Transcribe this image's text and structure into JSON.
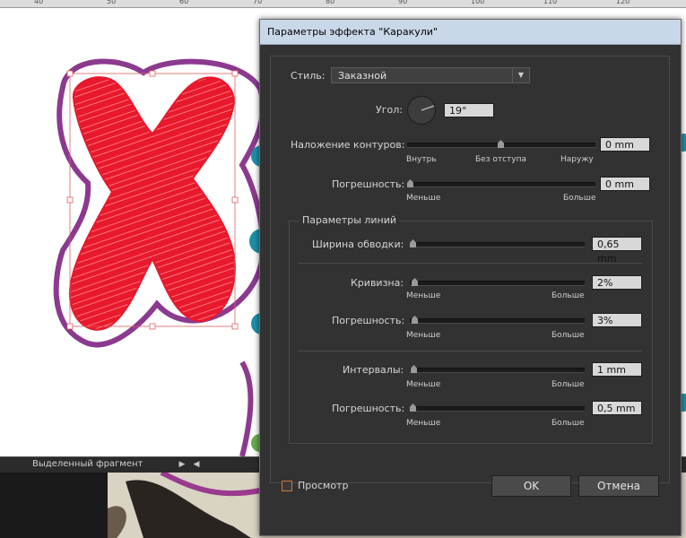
{
  "ruler": {
    "numbers": [
      "40",
      "50",
      "60",
      "70",
      "80",
      "90",
      "100",
      "110",
      "120"
    ]
  },
  "statusbar": {
    "label": "Выделенный фрагмент"
  },
  "dialog": {
    "title": "Параметры эффекта \"Каракули\"",
    "style_label": "Стиль:",
    "style_value": "Заказной",
    "angle_label": "Угол:",
    "angle_value": "19°",
    "angle_degrees": 19,
    "path_overlap": {
      "label": "Наложение контуров:",
      "value": "0 mm",
      "slider_fraction": 0.5,
      "left_caption": "Внутрь",
      "mid_caption": "Без отступа",
      "right_caption": "Наружу"
    },
    "variation1": {
      "label": "Погрешность:",
      "value": "0 mm",
      "slider_fraction": 0,
      "left_caption": "Меньше",
      "right_caption": "Больше"
    },
    "line_options": {
      "title": "Параметры линий",
      "stroke_width": {
        "label": "Ширина обводки:",
        "value": "0,65 mm",
        "slider_fraction": 0
      },
      "curviness": {
        "label": "Кривизна:",
        "value": "2%",
        "slider_fraction": 0.02,
        "left_caption": "Меньше",
        "right_caption": "Больше"
      },
      "curviness_variation": {
        "label": "Погрешность:",
        "value": "3%",
        "slider_fraction": 0.03,
        "left_caption": "Меньше",
        "right_caption": "Больше"
      },
      "spacing": {
        "label": "Интервалы:",
        "value": "1 mm",
        "slider_fraction": 0.01,
        "left_caption": "Меньше",
        "right_caption": "Больше"
      },
      "spacing_variation": {
        "label": "Погрешность:",
        "value": "0,5 mm",
        "slider_fraction": 0.005,
        "left_caption": "Меньше",
        "right_caption": "Больше"
      }
    },
    "preview_label": "Просмотр",
    "ok_label": "OK",
    "cancel_label": "Отмена"
  },
  "colors": {
    "fill_red": "#e8192c",
    "outline_purple": "#8b3a8f",
    "teal": "#1e8fa8",
    "dialog_bg": "#323232",
    "title_bg": "#c9d8e9",
    "preview_checkbox": "#c47a3c"
  },
  "icons": {
    "dropdown": "chevron-down-icon",
    "angle": "angle-dial-icon",
    "nav_next": "triangle-right-icon",
    "nav_prev": "triangle-left-icon"
  }
}
